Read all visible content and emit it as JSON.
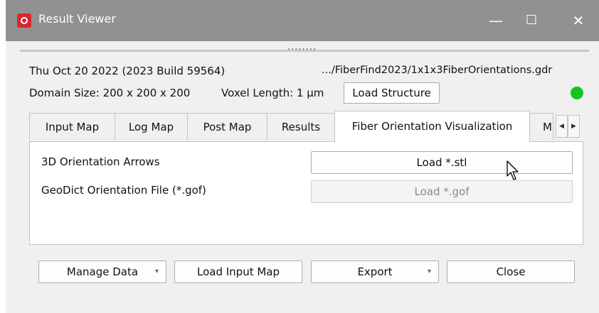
{
  "window": {
    "title": "Result Viewer"
  },
  "window_controls": {
    "minimize": "—",
    "maximize": "☐",
    "close": "✕"
  },
  "splitter": {
    "dots": "........"
  },
  "header": {
    "date_build": "Thu Oct 20 2022 (2023 Build 59564)",
    "file_path": ".../FiberFind2023/1x1x3FiberOrientations.gdr",
    "domain_size": "Domain Size: 200 x 200 x 200",
    "voxel_length": "Voxel Length: 1 µm",
    "load_structure_label": "Load Structure",
    "status_color": "#14c41e"
  },
  "tabs": [
    {
      "label": "Input Map"
    },
    {
      "label": "Log Map"
    },
    {
      "label": "Post Map"
    },
    {
      "label": "Results"
    },
    {
      "label": "Fiber Orientation Visualization",
      "active": true
    },
    {
      "label": "M"
    }
  ],
  "tab_scroll": {
    "left": "◀",
    "right": "▶"
  },
  "panel": {
    "rows": [
      {
        "label": "3D Orientation Arrows",
        "button": "Load *.stl",
        "enabled": true
      },
      {
        "label": "GeoDict Orientation File (*.gof)",
        "button": "Load *.gof",
        "enabled": false
      }
    ]
  },
  "footer": {
    "manage_data": "Manage Data",
    "load_input_map": "Load Input Map",
    "export": "Export",
    "close": "Close",
    "dropdown_arrow": "▾"
  }
}
